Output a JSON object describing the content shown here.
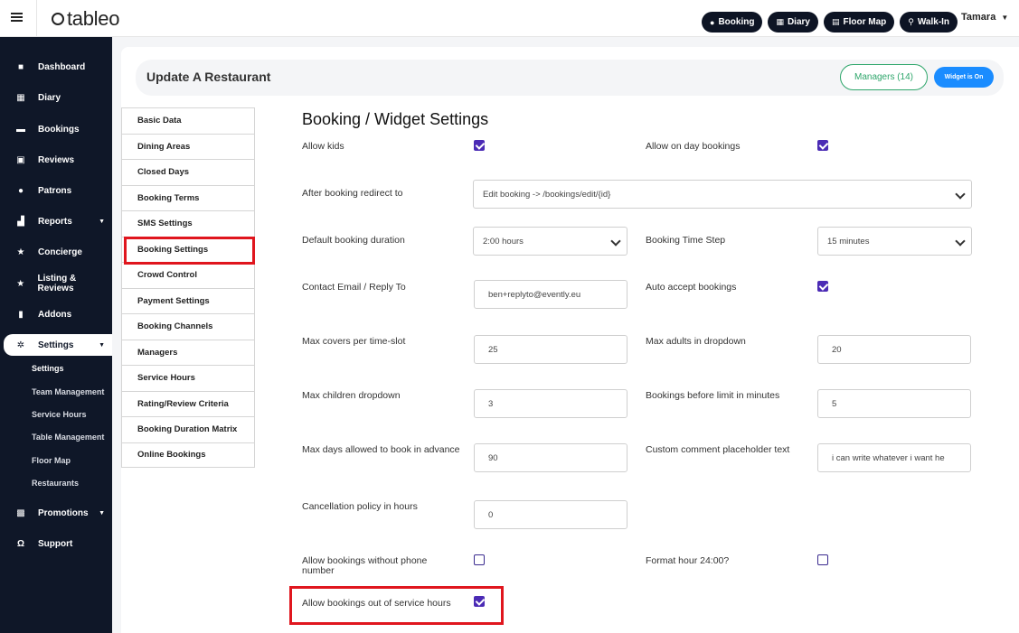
{
  "app": {
    "logo": "tableo",
    "user": "Tamara"
  },
  "topbar": {
    "buttons": [
      {
        "label": "Booking",
        "icon": "plus-circle-icon"
      },
      {
        "label": "Diary",
        "icon": "calendar-icon"
      },
      {
        "label": "Floor Map",
        "icon": "map-icon"
      },
      {
        "label": "Walk-In",
        "icon": "walking-icon"
      }
    ]
  },
  "sidebar": {
    "items": [
      {
        "label": "Dashboard",
        "icon": "dashboard-icon"
      },
      {
        "label": "Diary",
        "icon": "calendar-icon"
      },
      {
        "label": "Bookings",
        "icon": "book-icon"
      },
      {
        "label": "Reviews",
        "icon": "comment-check-icon"
      },
      {
        "label": "Patrons",
        "icon": "user-icon"
      },
      {
        "label": "Reports",
        "icon": "chart-icon"
      },
      {
        "label": "Concierge",
        "icon": "star-icon"
      },
      {
        "label": "Listing & Reviews",
        "icon": "star-icon"
      },
      {
        "label": "Addons",
        "icon": "plug-icon"
      },
      {
        "label": "Settings",
        "icon": "gear-icon"
      },
      {
        "label": "Promotions",
        "icon": "gift-icon"
      },
      {
        "label": "Support",
        "icon": "headset-icon"
      }
    ],
    "settings_sub": [
      "Settings",
      "Team Management",
      "Service Hours",
      "Table Management",
      "Floor Map",
      "Restaurants"
    ]
  },
  "header": {
    "title": "Update A Restaurant",
    "managers_label": "Managers (14)",
    "widget_label": "Widget is On"
  },
  "tabs": [
    "Basic Data",
    "Dining Areas",
    "Closed Days",
    "Booking Terms",
    "SMS Settings",
    "Booking Settings",
    "Crowd Control",
    "Payment Settings",
    "Booking Channels",
    "Managers",
    "Service Hours",
    "Rating/Review Criteria",
    "Booking Duration Matrix",
    "Online Bookings"
  ],
  "form": {
    "title": "Booking / Widget Settings",
    "allow_kids": {
      "label": "Allow kids",
      "checked": true
    },
    "allow_on_day": {
      "label": "Allow on day bookings",
      "checked": true
    },
    "redirect": {
      "label": "After booking redirect to",
      "value": "Edit booking -> /bookings/edit/{id}"
    },
    "default_duration": {
      "label": "Default booking duration",
      "value": "2:00 hours"
    },
    "time_step": {
      "label": "Booking Time Step",
      "value": "15 minutes"
    },
    "contact_email": {
      "label": "Contact Email / Reply To",
      "value": "ben+replyto@evently.eu"
    },
    "auto_accept": {
      "label": "Auto accept bookings",
      "checked": true
    },
    "max_covers": {
      "label": "Max covers per time-slot",
      "value": "25"
    },
    "max_adults": {
      "label": "Max adults in dropdown",
      "value": "20"
    },
    "max_children": {
      "label": "Max children dropdown",
      "value": "3"
    },
    "before_limit": {
      "label": "Bookings before limit in minutes",
      "value": "5"
    },
    "max_days": {
      "label": "Max days allowed to book in advance",
      "value": "90"
    },
    "comment_placeholder": {
      "label": "Custom comment placeholder text",
      "value": "i can write whatever i want he"
    },
    "cancellation": {
      "label": "Cancellation policy in hours",
      "value": "0"
    },
    "without_phone": {
      "label": "Allow bookings without phone number",
      "checked": false
    },
    "format_24": {
      "label": "Format hour 24:00?",
      "checked": false
    },
    "out_of_service": {
      "label": "Allow bookings out of service hours",
      "checked": true
    }
  }
}
